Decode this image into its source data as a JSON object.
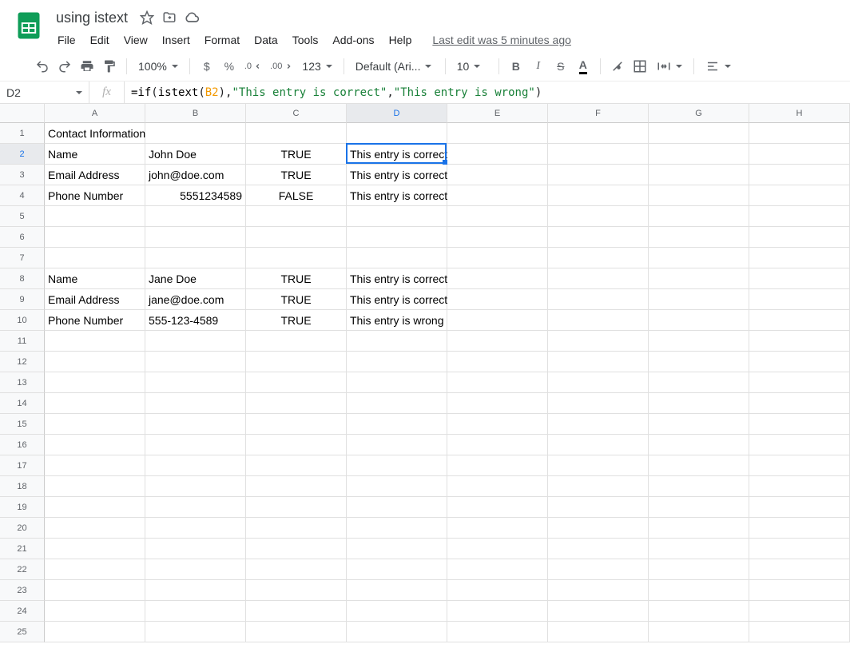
{
  "doc": {
    "title": "using istext",
    "last_edit": "Last edit was 5 minutes ago"
  },
  "menu": {
    "file": "File",
    "edit": "Edit",
    "view": "View",
    "insert": "Insert",
    "format": "Format",
    "data": "Data",
    "tools": "Tools",
    "addons": "Add-ons",
    "help": "Help"
  },
  "toolbar": {
    "zoom": "100%",
    "currency": "$",
    "percent": "%",
    "dec_dec": ".0",
    "dec_inc": ".00",
    "num_fmt": "123",
    "font": "Default (Ari...",
    "size": "10",
    "bold": "B",
    "italic": "I",
    "strike": "S",
    "textcolor": "A"
  },
  "namebox": {
    "ref": "D2"
  },
  "formula": {
    "raw": "=if(istext(B2),\"This entry is correct\",\"This entry is wrong\")",
    "tok1": "=if",
    "tok2": "(",
    "tok3": "istext",
    "tok4": "(",
    "tok5": "B2",
    "tok6": ")",
    "tok7": ",",
    "tok8": "\"This entry is correct\"",
    "tok9": ",",
    "tok10": "\"This entry is wrong\"",
    "tok11": ")"
  },
  "columns": [
    "A",
    "B",
    "C",
    "D",
    "E",
    "F",
    "G",
    "H"
  ],
  "row_count": 25,
  "selected": {
    "col": "D",
    "row": 2
  },
  "cells": {
    "r1": {
      "A": "Contact Information"
    },
    "r2": {
      "A": "Name",
      "B": "John Doe",
      "C": "TRUE",
      "D": "This entry is correct"
    },
    "r3": {
      "A": "Email Address",
      "B": "john@doe.com",
      "C": "TRUE",
      "D": "This entry is correct"
    },
    "r4": {
      "A": "Phone Number",
      "B": "5551234589",
      "C": "FALSE",
      "D": "This entry is correct"
    },
    "r5": {},
    "r6": {},
    "r7": {},
    "r8": {
      "A": "Name",
      "B": "Jane Doe",
      "C": "TRUE",
      "D": "This entry is correct"
    },
    "r9": {
      "A": "Email Address",
      "B": "jane@doe.com",
      "C": "TRUE",
      "D": "This entry is correct"
    },
    "r10": {
      "A": "Phone Number",
      "B": "555-123-4589",
      "C": "TRUE",
      "D": "This entry is wrong"
    }
  },
  "cell_align": {
    "r2C": "center",
    "r3C": "center",
    "r4C": "center",
    "r8C": "center",
    "r9C": "center",
    "r10C": "center",
    "r4B": "right"
  }
}
